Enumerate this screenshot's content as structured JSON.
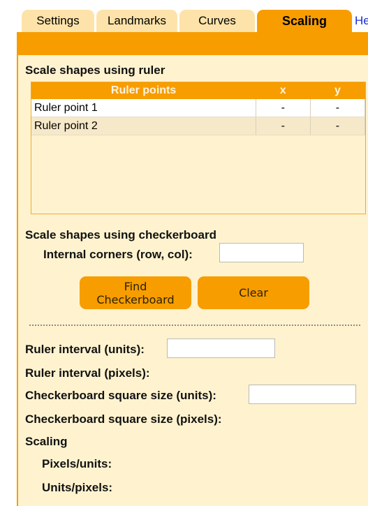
{
  "tabs": {
    "settings": "Settings",
    "landmarks": "Landmarks",
    "curves": "Curves",
    "scaling": "Scaling",
    "help": "Help"
  },
  "ruler_section": {
    "heading": "Scale shapes using ruler",
    "columns": [
      "Ruler points",
      "x",
      "y"
    ],
    "rows": [
      {
        "name": "Ruler point 1",
        "x": "-",
        "y": "-"
      },
      {
        "name": "Ruler point 2",
        "x": "-",
        "y": "-"
      }
    ]
  },
  "checkerboard_section": {
    "heading": "Scale shapes using checkerboard",
    "corners_label": "Internal corners (row, col):",
    "corners_value": "",
    "find_button_line1": "Find",
    "find_button_line2": "Checkerboard",
    "clear_button": "Clear"
  },
  "measurements": {
    "ruler_interval_units_label": "Ruler interval (units):",
    "ruler_interval_units_value": "",
    "ruler_interval_pixels_label": "Ruler interval (pixels):",
    "checker_square_units_label": "Checkerboard square size (units):",
    "checker_square_units_value": "",
    "checker_square_pixels_label": "Checkerboard square size (pixels):",
    "scaling_heading": "Scaling",
    "pixels_per_units_label": "Pixels/units:",
    "units_per_pixels_label": "Units/pixels:"
  },
  "colors": {
    "accent": "#f79d00",
    "tab_inactive": "#fde3a9",
    "panel_bg": "#fff3cf",
    "help_link": "#1a2fd0"
  }
}
